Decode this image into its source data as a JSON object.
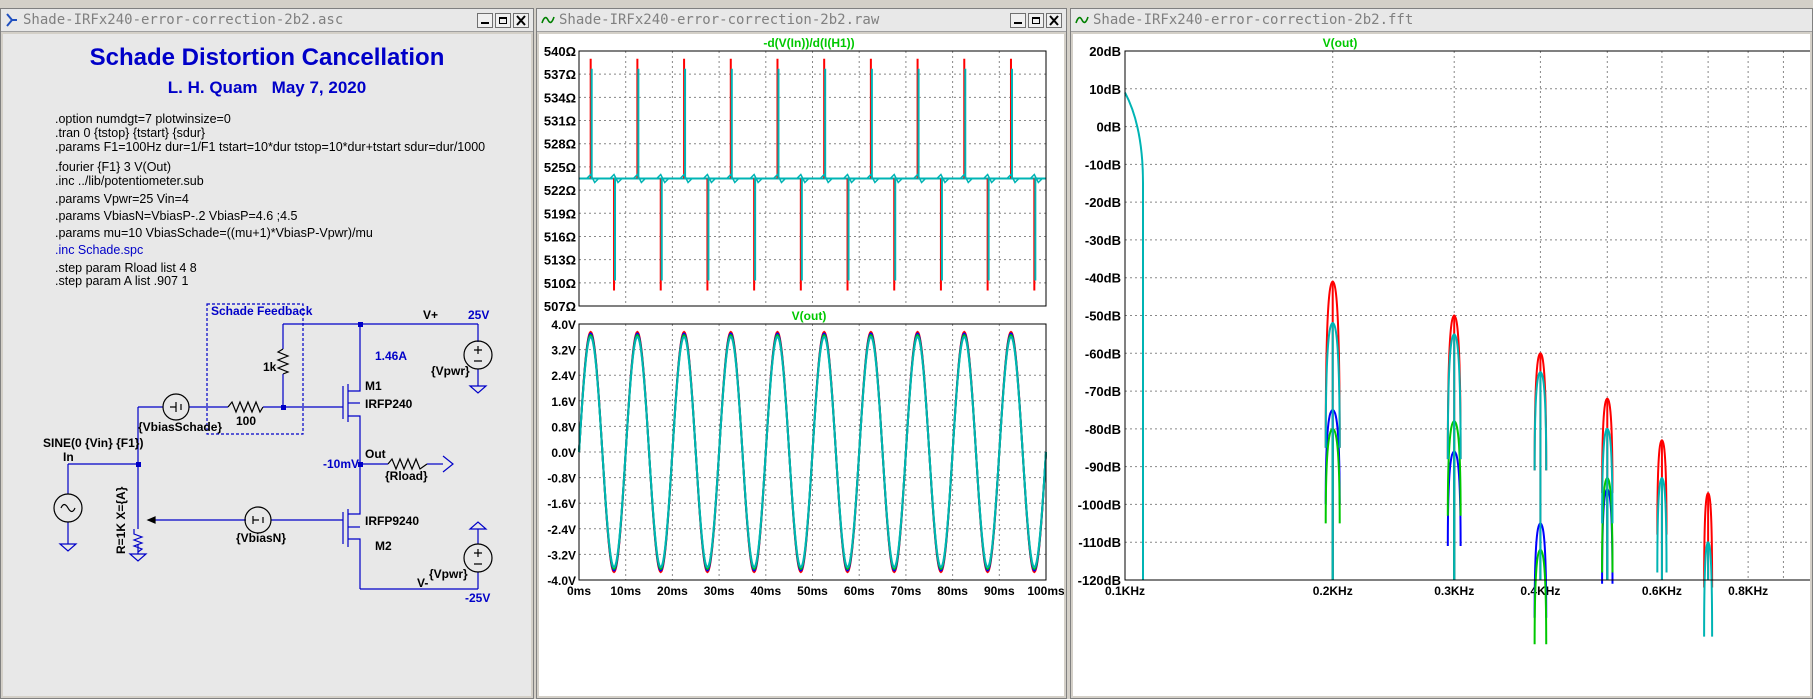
{
  "schematic": {
    "window_title": "Shade-IRFx240-error-correction-2b2.asc",
    "title": "Schade Distortion Cancellation",
    "author_line": "L. H. Quam   May 7, 2020",
    "directives": [
      ".option numdgt=7 plotwinsize=0",
      ".tran 0 {tstop} {tstart} {sdur}",
      ".params F1=100Hz dur=1/F1 tstart=10*dur tstop=10*dur+tstart sdur=dur/1000",
      ".fourier {F1} 3 V(Out)",
      ".inc ../lib/potentiometer.sub",
      ".params Vpwr=25 Vin=4",
      ".params VbiasN=VbiasP-.2 VbiasP=4.6 ;4.5",
      ".params mu=10 VbiasSchade=((mu+1)*VbiasP-Vpwr)/mu",
      ".inc Schade.spc",
      ".step param Rload list 4 8",
      ".step param A list .907 1"
    ],
    "labels": {
      "feedback_box": "Schade Feedback",
      "vplus": "V+",
      "v25": "25V",
      "current": "1.46A",
      "r1k": "1k",
      "m1": "M1",
      "irfp240": "IRFP240",
      "vpwr_top": "{Vpwr}",
      "r100": "100",
      "vbias_schade": "{VbiasSchade}",
      "sine": "SINE(0 {Vin} {F1})",
      "in": "In",
      "out": "Out",
      "minus10mv": "-10mV",
      "rload": "{Rload}",
      "pot": "R=1K X={A}",
      "vbias_n": "{VbiasN}",
      "irfp9240": "IRFP9240",
      "m2": "M2",
      "vpwr_bot": "{Vpwr}",
      "vminus": "V-",
      "vm25": "-25V"
    }
  },
  "raw_window": {
    "window_title": "Shade-IRFx240-error-correction-2b2.raw",
    "top_plot": {
      "trace_label": "-d(V(In))/d(I(H1))",
      "y_ticks": [
        "540Ω",
        "537Ω",
        "534Ω",
        "531Ω",
        "528Ω",
        "525Ω",
        "522Ω",
        "519Ω",
        "516Ω",
        "513Ω",
        "510Ω",
        "507Ω"
      ]
    },
    "bottom_plot": {
      "trace_label": "V(out)",
      "y_ticks": [
        "4.0V",
        "3.2V",
        "2.4V",
        "1.6V",
        "0.8V",
        "0.0V",
        "-0.8V",
        "-1.6V",
        "-2.4V",
        "-3.2V",
        "-4.0V"
      ],
      "x_ticks": [
        "0ms",
        "10ms",
        "20ms",
        "30ms",
        "40ms",
        "50ms",
        "60ms",
        "70ms",
        "80ms",
        "90ms",
        "100ms"
      ]
    }
  },
  "fft_window": {
    "window_title": "Shade-IRFx240-error-correction-2b2.fft",
    "trace_label": "V(out)",
    "y_ticks": [
      "20dB",
      "10dB",
      "0dB",
      "-10dB",
      "-20dB",
      "-30dB",
      "-40dB",
      "-50dB",
      "-60dB",
      "-70dB",
      "-80dB",
      "-90dB",
      "-100dB",
      "-110dB",
      "-120dB"
    ],
    "x_ticks": [
      "0.1KHz",
      "0.2KHz",
      "0.3KHz",
      "0.4KHz",
      "0.6KHz",
      "0.8KHz"
    ]
  },
  "colors": {
    "label_green": "#00c800",
    "title_blue": "#0000c8",
    "trace_red": "#ff0000",
    "trace_blue": "#0000ff",
    "trace_green": "#00c800",
    "trace_teal": "#00b4b4"
  },
  "chart_data": [
    {
      "type": "line",
      "title": "-d(V(In))/d(I(H1))",
      "ylim": [
        507,
        540
      ],
      "xlim": [
        0,
        100
      ],
      "y_unit": "Ω",
      "x_unit": "ms",
      "baseline": 523.5,
      "spike_period_ms": 5,
      "spike_max": 539,
      "spike_min": 509,
      "grid": true
    },
    {
      "type": "line",
      "title": "V(out)",
      "ylim": [
        -4.0,
        4.0
      ],
      "xlim": [
        0,
        100
      ],
      "y_unit": "V",
      "x_unit": "ms",
      "frequency_hz": 100,
      "series": [
        {
          "amplitude": 3.75
        },
        {
          "amplitude": 3.7
        },
        {
          "amplitude": 3.65
        },
        {
          "amplitude": 3.6
        }
      ],
      "grid": true
    },
    {
      "type": "line",
      "title": "V(out)",
      "ylim": [
        -120,
        20
      ],
      "x_scale": "log",
      "x_unit": "KHz",
      "xlim": [
        0.1,
        1.0
      ],
      "harmonics_khz": [
        0.2,
        0.3,
        0.4,
        0.5,
        0.6,
        0.7
      ],
      "series": [
        {
          "peaks_db": [
            -41,
            -50,
            -60,
            -72,
            -83,
            -97
          ]
        },
        {
          "peaks_db": [
            -75,
            -86,
            -105,
            -96,
            -120,
            -120
          ]
        },
        {
          "peaks_db": [
            -80,
            -78,
            -112,
            -93,
            -120,
            -120
          ]
        },
        {
          "peaks_db": [
            -52,
            -55,
            -65,
            -80,
            -93,
            -110
          ]
        }
      ],
      "grid": true
    }
  ]
}
